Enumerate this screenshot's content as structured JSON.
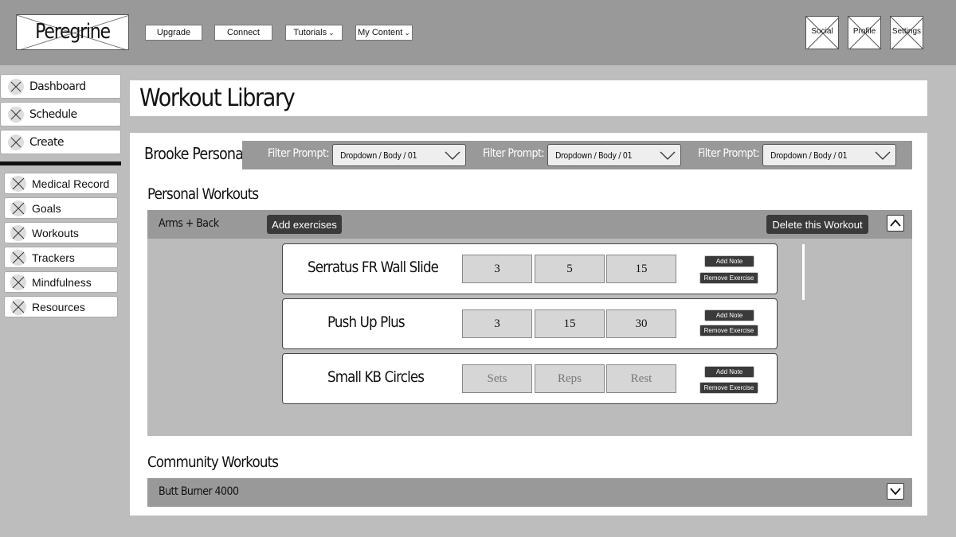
{
  "header": {
    "logo_text": "Peregrine",
    "nav": [
      {
        "label": "Upgrade"
      },
      {
        "label": "Connect"
      },
      {
        "label": "Tutorials"
      },
      {
        "label": "My Content"
      }
    ],
    "icons": [
      {
        "label": "Social"
      },
      {
        "label": "Profile"
      },
      {
        "label": "Settings"
      }
    ]
  },
  "sidebar": {
    "primary": [
      {
        "label": "Dashboard"
      },
      {
        "label": "Schedule"
      },
      {
        "label": "Create"
      }
    ],
    "secondary": [
      {
        "label": "Medical Record"
      },
      {
        "label": "Goals"
      },
      {
        "label": "Workouts"
      },
      {
        "label": "Trackers"
      },
      {
        "label": "Mindfulness"
      },
      {
        "label": "Resources"
      }
    ]
  },
  "page": {
    "title": "Workout Library",
    "persona": "Brooke Persona",
    "filters": [
      {
        "prompt": "Filter Prompt:",
        "value": "Dropdown / Body / 01"
      },
      {
        "prompt": "Filter Prompt:",
        "value": "Dropdown / Body / 01"
      },
      {
        "prompt": "Filter Prompt:",
        "value": "Dropdown / Body / 01"
      }
    ]
  },
  "personal": {
    "section_title": "Personal Workouts",
    "workout": {
      "name": "Arms + Back",
      "add_label": "Add exercises",
      "delete_label": "Delete this Workout",
      "exercises": [
        {
          "name": "Serratus FR Wall Slide",
          "sets": "3",
          "reps": "5",
          "rest": "15",
          "add_note": "Add Note",
          "remove": "Remove Exercise"
        },
        {
          "name": "Push Up Plus",
          "sets": "3",
          "reps": "15",
          "rest": "30",
          "add_note": "Add Note",
          "remove": "Remove Exercise"
        },
        {
          "name": "Small KB Circles",
          "sets": "Sets",
          "reps": "Reps",
          "rest": "Rest",
          "add_note": "Add Note",
          "remove": "Remove Exercise"
        }
      ]
    }
  },
  "community": {
    "section_title": "Community Workouts",
    "workout": {
      "name": "Butt Burner 4000"
    }
  }
}
